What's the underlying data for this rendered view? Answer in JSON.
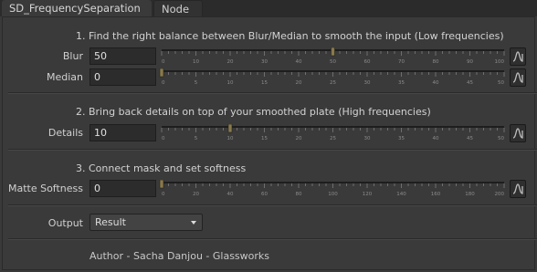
{
  "tabs": [
    {
      "label": "SD_FrequencySeparation",
      "active": true
    },
    {
      "label": "Node",
      "active": false
    }
  ],
  "sections": [
    {
      "title": "1.  Find the right balance between Blur/Median to smooth the input (Low frequencies)",
      "params": [
        {
          "label": "Blur",
          "value": "50",
          "range": [
            0,
            100
          ],
          "ticks": [
            "0",
            "10",
            "20",
            "30",
            "40",
            "50",
            "60",
            "70",
            "80",
            "90",
            "100"
          ]
        },
        {
          "label": "Median",
          "value": "0",
          "range": [
            0,
            50
          ],
          "ticks": [
            "0",
            "5",
            "10",
            "15",
            "20",
            "25",
            "30",
            "35",
            "40",
            "45",
            "50"
          ]
        }
      ]
    },
    {
      "title": "2.  Bring back details on top of your smoothed plate (High frequencies)",
      "params": [
        {
          "label": "Details",
          "value": "10",
          "range": [
            0,
            50
          ],
          "ticks": [
            "0",
            "5",
            "10",
            "15",
            "20",
            "25",
            "30",
            "35",
            "40",
            "45",
            "50"
          ]
        }
      ]
    },
    {
      "title": "3.  Connect mask and set softness",
      "params": [
        {
          "label": "Matte Softness",
          "value": "0",
          "range": [
            0,
            200
          ],
          "ticks": [
            "0",
            "20",
            "40",
            "60",
            "80",
            "100",
            "120",
            "140",
            "160",
            "180",
            "200"
          ]
        }
      ]
    }
  ],
  "output": {
    "label": "Output",
    "value": "Result"
  },
  "author": "Author - Sacha Danjou - Glassworks",
  "colors": {
    "background": "#3a3a3a",
    "field_bg": "#2c2c2c",
    "slider_handle": "#8a7a4a",
    "tick": "#7a7a7a"
  }
}
